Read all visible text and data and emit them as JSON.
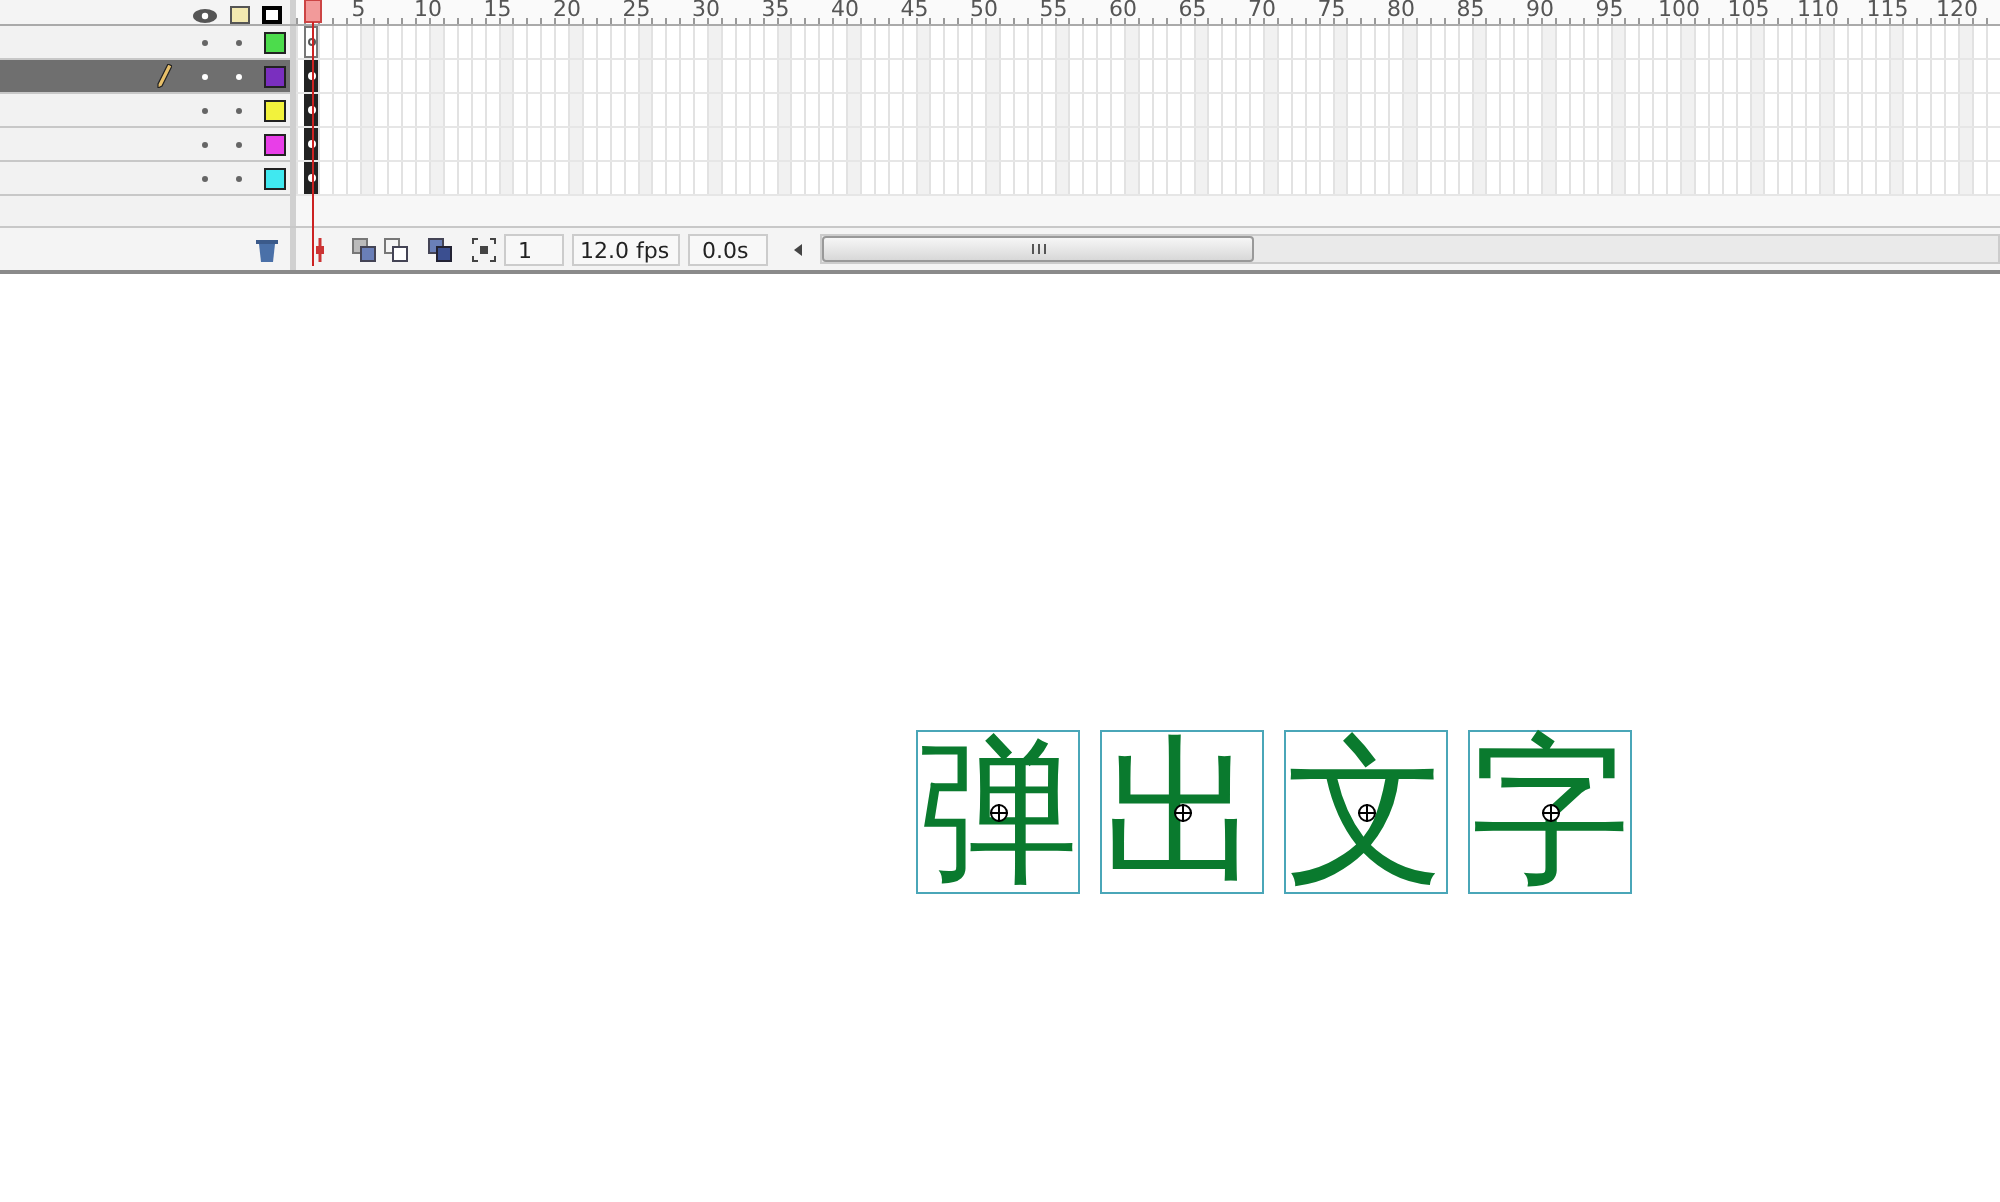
{
  "timeline": {
    "ruler_labels": [
      "5",
      "10",
      "15",
      "20",
      "25",
      "30",
      "35",
      "40",
      "45",
      "50",
      "55",
      "60",
      "65",
      "70",
      "75",
      "80",
      "85",
      "90",
      "95",
      "100",
      "105",
      "110",
      "115",
      "120"
    ],
    "layers": [
      {
        "selected": false,
        "editing": false,
        "color": "#4cdc4c",
        "keyframe_filled": false
      },
      {
        "selected": true,
        "editing": true,
        "color": "#7a2fbf",
        "keyframe_filled": true
      },
      {
        "selected": false,
        "editing": false,
        "color": "#f2f23c",
        "keyframe_filled": true
      },
      {
        "selected": false,
        "editing": false,
        "color": "#e83ee8",
        "keyframe_filled": true
      },
      {
        "selected": false,
        "editing": false,
        "color": "#40e8f0",
        "keyframe_filled": true
      }
    ],
    "frame_counter": "1",
    "frame_rate": "12.0 fps",
    "elapsed_time": "0.0s"
  },
  "stage": {
    "characters": [
      {
        "text": "弹"
      },
      {
        "text": "出"
      },
      {
        "text": "文"
      },
      {
        "text": "字"
      }
    ]
  }
}
